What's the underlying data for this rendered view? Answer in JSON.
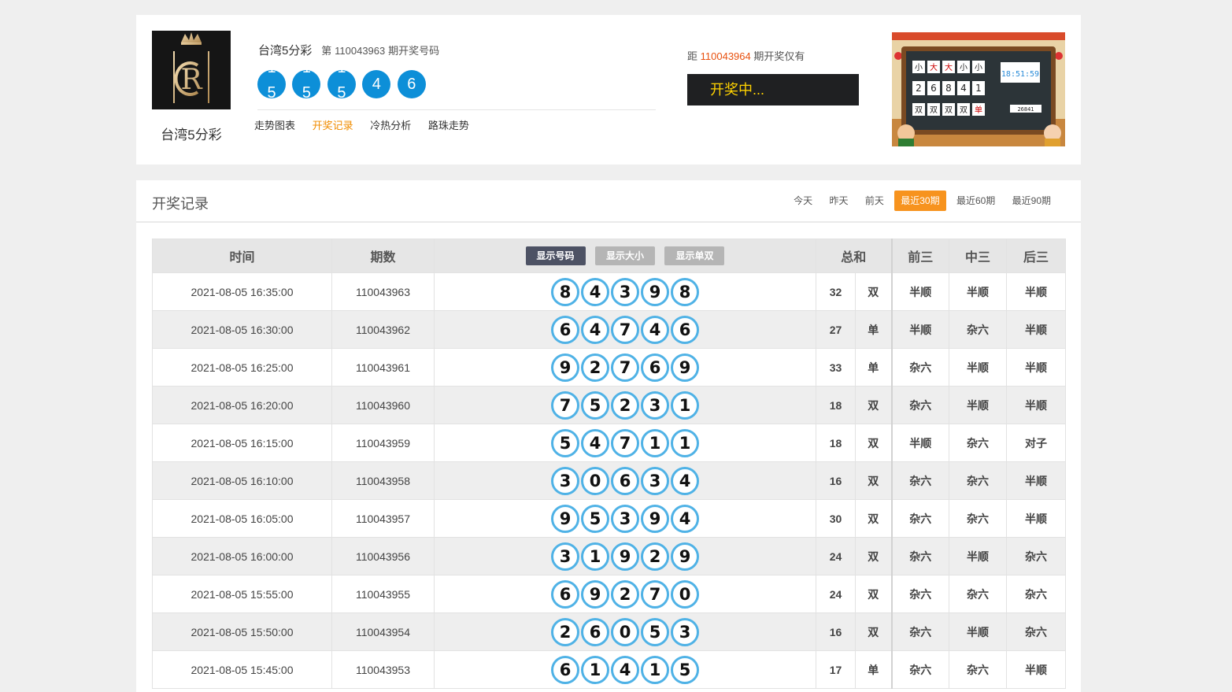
{
  "lottery": {
    "name": "台湾5分彩",
    "logo_name": "台湾5分彩",
    "issue_prefix": "第",
    "current_issue": "110043963",
    "issue_suffix": "期开奖号码",
    "balls_rolling": [
      "5",
      "5",
      "5"
    ],
    "balls_static": [
      "4",
      "6"
    ],
    "next_prefix": "距",
    "next_issue": "110043964",
    "next_suffix": "期开奖仅有",
    "status": "开奖中..."
  },
  "nav": [
    "走势图表",
    "开奖记录",
    "冷热分析",
    "路珠走势"
  ],
  "nav_active": 1,
  "records": {
    "title": "开奖记录",
    "filters": [
      "今天",
      "昨天",
      "前天",
      "最近30期",
      "最近60期",
      "最近90期"
    ],
    "filter_active": 3,
    "headers": {
      "time": "时间",
      "issue": "期数",
      "show_number": "显示号码",
      "show_size": "显示大小",
      "show_parity": "显示单双",
      "sum": "总和",
      "front3": "前三",
      "mid3": "中三",
      "back3": "后三"
    },
    "rows": [
      {
        "time": "2021-08-05 16:35:00",
        "issue": "110043963",
        "nums": [
          "8",
          "4",
          "3",
          "9",
          "8"
        ],
        "sum": "32",
        "sp": "双",
        "f": "半顺",
        "m": "半顺",
        "b": "半顺"
      },
      {
        "time": "2021-08-05 16:30:00",
        "issue": "110043962",
        "nums": [
          "6",
          "4",
          "7",
          "4",
          "6"
        ],
        "sum": "27",
        "sp": "单",
        "f": "半顺",
        "m": "杂六",
        "b": "半顺"
      },
      {
        "time": "2021-08-05 16:25:00",
        "issue": "110043961",
        "nums": [
          "9",
          "2",
          "7",
          "6",
          "9"
        ],
        "sum": "33",
        "sp": "单",
        "f": "杂六",
        "m": "半顺",
        "b": "半顺"
      },
      {
        "time": "2021-08-05 16:20:00",
        "issue": "110043960",
        "nums": [
          "7",
          "5",
          "2",
          "3",
          "1"
        ],
        "sum": "18",
        "sp": "双",
        "f": "杂六",
        "m": "半顺",
        "b": "半顺"
      },
      {
        "time": "2021-08-05 16:15:00",
        "issue": "110043959",
        "nums": [
          "5",
          "4",
          "7",
          "1",
          "1"
        ],
        "sum": "18",
        "sp": "双",
        "f": "半顺",
        "m": "杂六",
        "b": "对子"
      },
      {
        "time": "2021-08-05 16:10:00",
        "issue": "110043958",
        "nums": [
          "3",
          "0",
          "6",
          "3",
          "4"
        ],
        "sum": "16",
        "sp": "双",
        "f": "杂六",
        "m": "杂六",
        "b": "半顺"
      },
      {
        "time": "2021-08-05 16:05:00",
        "issue": "110043957",
        "nums": [
          "9",
          "5",
          "3",
          "9",
          "4"
        ],
        "sum": "30",
        "sp": "双",
        "f": "杂六",
        "m": "杂六",
        "b": "半顺"
      },
      {
        "time": "2021-08-05 16:00:00",
        "issue": "110043956",
        "nums": [
          "3",
          "1",
          "9",
          "2",
          "9"
        ],
        "sum": "24",
        "sp": "双",
        "f": "杂六",
        "m": "半顺",
        "b": "杂六"
      },
      {
        "time": "2021-08-05 15:55:00",
        "issue": "110043955",
        "nums": [
          "6",
          "9",
          "2",
          "7",
          "0"
        ],
        "sum": "24",
        "sp": "双",
        "f": "杂六",
        "m": "杂六",
        "b": "杂六"
      },
      {
        "time": "2021-08-05 15:50:00",
        "issue": "110043954",
        "nums": [
          "2",
          "6",
          "0",
          "5",
          "3"
        ],
        "sum": "16",
        "sp": "双",
        "f": "杂六",
        "m": "半顺",
        "b": "杂六"
      },
      {
        "time": "2021-08-05 15:45:00",
        "issue": "110043953",
        "nums": [
          "6",
          "1",
          "4",
          "1",
          "5"
        ],
        "sum": "17",
        "sp": "单",
        "f": "杂六",
        "m": "杂六",
        "b": "半顺"
      }
    ]
  },
  "board_display": {
    "row1": [
      "小",
      "大",
      "大",
      "小",
      "小"
    ],
    "row2": [
      "2",
      "6",
      "8",
      "4",
      "1"
    ],
    "row3": [
      "双",
      "双",
      "双",
      "双",
      "单"
    ],
    "clock": "18:51:59",
    "mini_text": "26841"
  },
  "colors": {
    "accent_orange": "#f7931e",
    "issue_orange": "#e8500e",
    "ball_blue": "#0d8fd8",
    "ring_blue": "#4fb2e6",
    "result_red": "#d4121d"
  }
}
